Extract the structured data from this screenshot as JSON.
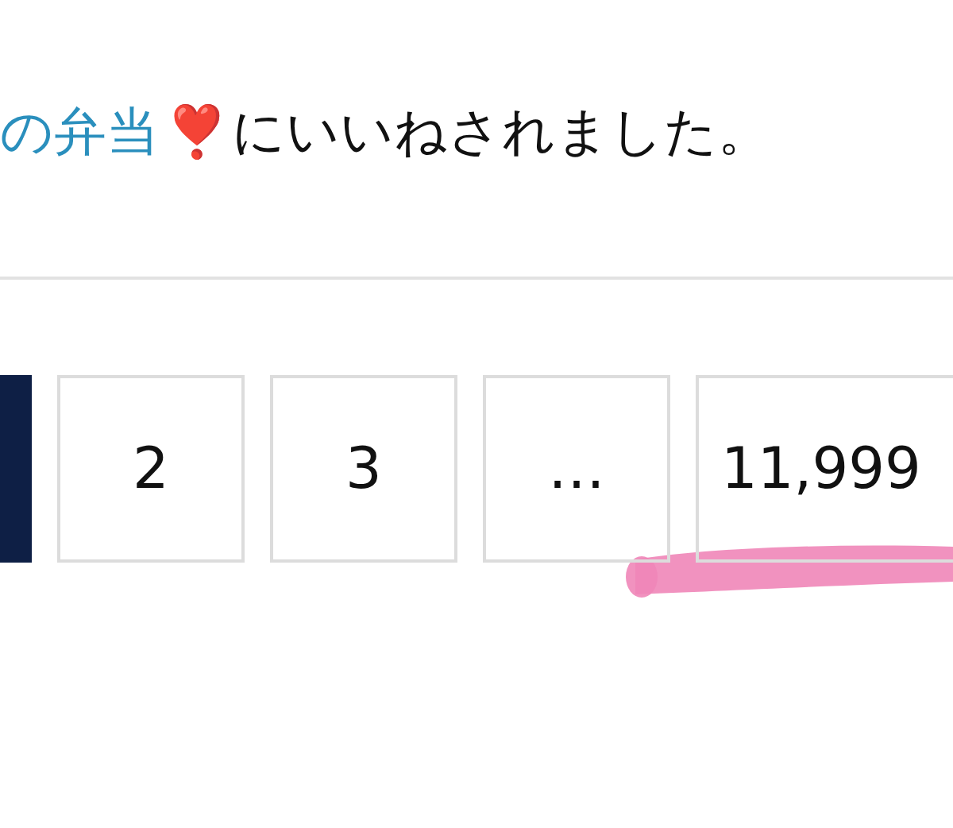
{
  "notification": {
    "link": "の弁当",
    "emoji": "❣️",
    "text": "にいいねされました。"
  },
  "pagination": [
    {
      "selected": true
    },
    {
      "label": "2",
      "selected": false
    },
    {
      "label": "3",
      "selected": false
    },
    {
      "label": "…",
      "selected": false
    },
    {
      "label": "11,999",
      "selected": false
    }
  ]
}
